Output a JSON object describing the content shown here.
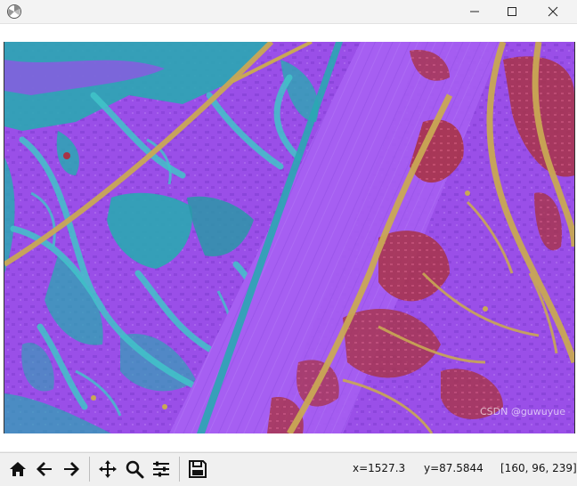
{
  "window": {
    "icon": "matplotlib-figure-icon",
    "controls": [
      "minimize-icon",
      "maximize-icon",
      "close-icon"
    ]
  },
  "toolbar": {
    "buttons": [
      {
        "name": "home",
        "icon": "home-icon"
      },
      {
        "name": "back",
        "icon": "arrow-left-icon"
      },
      {
        "name": "forward",
        "icon": "arrow-right-icon"
      },
      {
        "name": "pan",
        "icon": "move-icon"
      },
      {
        "name": "zoom",
        "icon": "magnifier-icon"
      },
      {
        "name": "configure-subplots",
        "icon": "sliders-icon"
      },
      {
        "name": "save",
        "icon": "floppy-disk-icon"
      }
    ]
  },
  "status": {
    "x": "x=1527.3",
    "y": "y=87.5844",
    "rgb": "[160, 96, 239]"
  },
  "image": {
    "content": "segmentation-overlay-aerial",
    "colors": {
      "purple": "#9a4fe8",
      "teal": "#2aa7b3",
      "cyan": "#41c4c9",
      "gold": "#c9a854",
      "red": "#a83347"
    }
  },
  "watermark": "CSDN @guwuyue"
}
